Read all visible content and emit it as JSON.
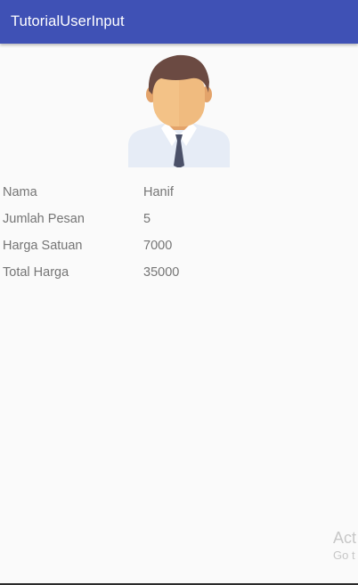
{
  "app_bar": {
    "title": "TutorialUserInput",
    "color": "#3f51b5"
  },
  "avatar": {
    "icon": "user-avatar-icon"
  },
  "order_info": {
    "rows": [
      {
        "label": "Nama",
        "value": "Hanif"
      },
      {
        "label": "Jumlah Pesan",
        "value": "5"
      },
      {
        "label": "Harga Satuan",
        "value": "7000"
      },
      {
        "label": "Total Harga",
        "value": "35000"
      }
    ]
  },
  "watermark": {
    "line1": "Act",
    "line2": "Go t"
  }
}
